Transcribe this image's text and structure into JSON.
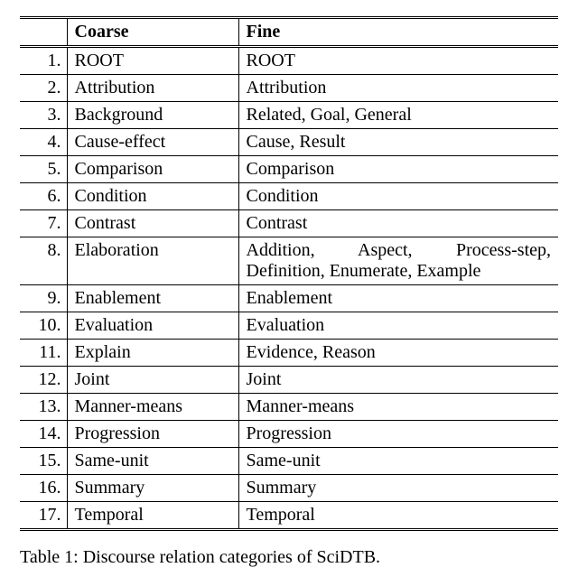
{
  "table": {
    "headers": {
      "num": "",
      "coarse": "Coarse",
      "fine": "Fine"
    },
    "rows": [
      {
        "num": "1.",
        "coarse": "ROOT",
        "fine": "ROOT"
      },
      {
        "num": "2.",
        "coarse": "Attribution",
        "fine": "Attribution"
      },
      {
        "num": "3.",
        "coarse": "Background",
        "fine": "Related, Goal, General"
      },
      {
        "num": "4.",
        "coarse": "Cause-effect",
        "fine": "Cause, Result"
      },
      {
        "num": "5.",
        "coarse": "Comparison",
        "fine": "Comparison"
      },
      {
        "num": "6.",
        "coarse": "Condition",
        "fine": "Condition"
      },
      {
        "num": "7.",
        "coarse": "Contrast",
        "fine": "Contrast"
      },
      {
        "num": "8.",
        "coarse": "Elaboration",
        "fine": "Addition, Aspect, Process-step, Definition, Enumerate, Example"
      },
      {
        "num": "9.",
        "coarse": "Enablement",
        "fine": "Enablement"
      },
      {
        "num": "10.",
        "coarse": "Evaluation",
        "fine": "Evaluation"
      },
      {
        "num": "11.",
        "coarse": "Explain",
        "fine": "Evidence, Reason"
      },
      {
        "num": "12.",
        "coarse": "Joint",
        "fine": "Joint"
      },
      {
        "num": "13.",
        "coarse": "Manner-means",
        "fine": "Manner-means"
      },
      {
        "num": "14.",
        "coarse": "Progression",
        "fine": "Progression"
      },
      {
        "num": "15.",
        "coarse": "Same-unit",
        "fine": "Same-unit"
      },
      {
        "num": "16.",
        "coarse": "Summary",
        "fine": "Summary"
      },
      {
        "num": "17.",
        "coarse": "Temporal",
        "fine": "Temporal"
      }
    ]
  },
  "caption_fragment": "Table 1: Discourse relation categories of SciDTB."
}
